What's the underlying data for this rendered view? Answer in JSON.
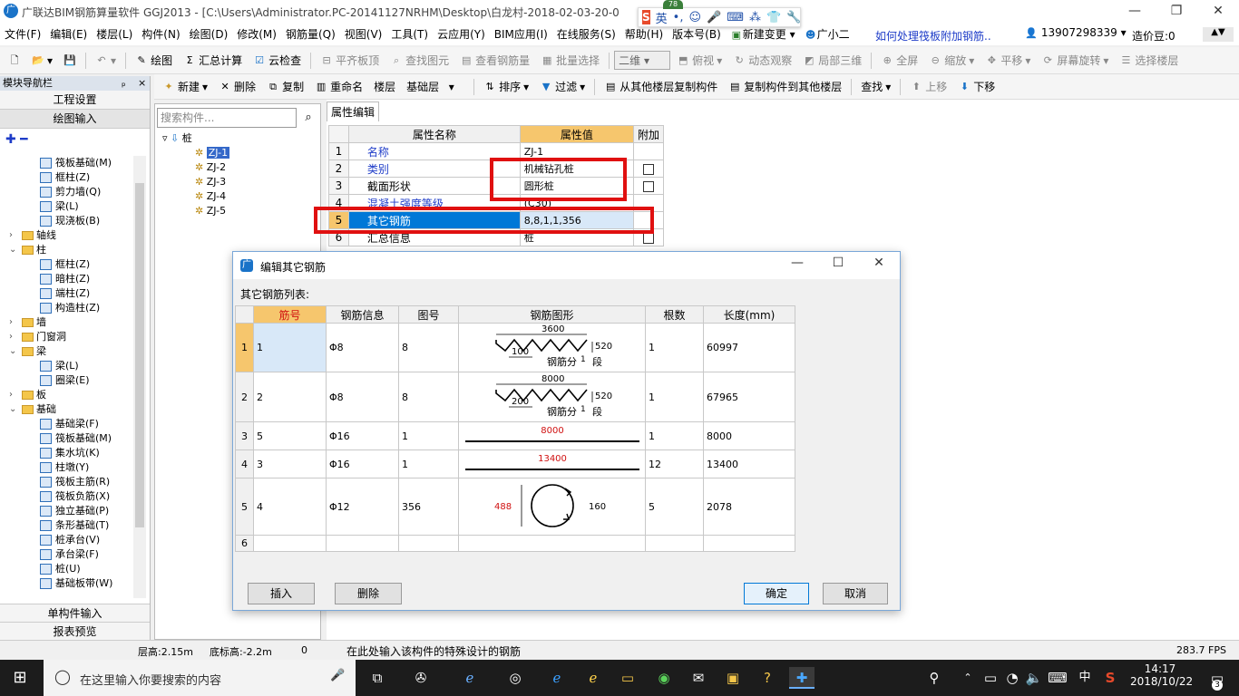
{
  "window": {
    "title": "广联达BIM钢筋算量软件 GGJ2013 - [C:\\Users\\Administrator.PC-20141127NRHM\\Desktop\\白龙村-2018-02-03-20-0"
  },
  "ime": {
    "badge": "78",
    "s": "S",
    "mode": "英"
  },
  "menu": {
    "items": [
      "文件(F)",
      "编辑(E)",
      "楼层(L)",
      "构件(N)",
      "绘图(D)",
      "修改(M)",
      "钢筋量(Q)",
      "视图(V)",
      "工具(T)",
      "云应用(Y)",
      "BIM应用(I)",
      "在线服务(S)",
      "帮助(H)",
      "版本号(B)",
      "新建变更",
      "广小二"
    ],
    "question": "如何处理筏板附加钢筋..",
    "phone": "13907298339",
    "coins": "造价豆:0"
  },
  "toolbar1": {
    "items": [
      "绘图",
      "汇总计算",
      "云检查",
      "平齐板顶",
      "查找图元",
      "查看钢筋量",
      "批量选择",
      "俯视",
      "动态观察",
      "局部三维",
      "全屏",
      "缩放",
      "平移",
      "屏幕旋转",
      "选择楼层"
    ],
    "view_combo": "二维"
  },
  "toolbar2": {
    "items": [
      "新建",
      "删除",
      "复制",
      "重命名",
      "楼层",
      "基础层",
      "排序",
      "过滤",
      "从其他楼层复制构件",
      "复制构件到其他楼层",
      "查找",
      "上移",
      "下移"
    ]
  },
  "nav": {
    "header": "模块导航栏",
    "pin": "ₚ",
    "close": "×",
    "buttons": [
      "工程设置",
      "绘图输入",
      "单构件输入",
      "报表预览"
    ],
    "tree": [
      {
        "label": "筏板基础(M)",
        "lvl": 2
      },
      {
        "label": "框柱(Z)",
        "lvl": 2
      },
      {
        "label": "剪力墙(Q)",
        "lvl": 2
      },
      {
        "label": "梁(L)",
        "lvl": 2
      },
      {
        "label": "现浇板(B)",
        "lvl": 2
      },
      {
        "label": "轴线",
        "lvl": 1,
        "ex": "+"
      },
      {
        "label": "柱",
        "lvl": 1,
        "ex": "−"
      },
      {
        "label": "框柱(Z)",
        "lvl": 2
      },
      {
        "label": "暗柱(Z)",
        "lvl": 2
      },
      {
        "label": "端柱(Z)",
        "lvl": 2
      },
      {
        "label": "构造柱(Z)",
        "lvl": 2
      },
      {
        "label": "墙",
        "lvl": 1,
        "ex": "+"
      },
      {
        "label": "门窗洞",
        "lvl": 1,
        "ex": "+"
      },
      {
        "label": "梁",
        "lvl": 1,
        "ex": "−"
      },
      {
        "label": "梁(L)",
        "lvl": 2
      },
      {
        "label": "圈梁(E)",
        "lvl": 2
      },
      {
        "label": "板",
        "lvl": 1,
        "ex": "+"
      },
      {
        "label": "基础",
        "lvl": 1,
        "ex": "−"
      },
      {
        "label": "基础梁(F)",
        "lvl": 2
      },
      {
        "label": "筏板基础(M)",
        "lvl": 2
      },
      {
        "label": "集水坑(K)",
        "lvl": 2
      },
      {
        "label": "柱墩(Y)",
        "lvl": 2
      },
      {
        "label": "筏板主筋(R)",
        "lvl": 2
      },
      {
        "label": "筏板负筋(X)",
        "lvl": 2
      },
      {
        "label": "独立基础(P)",
        "lvl": 2
      },
      {
        "label": "条形基础(T)",
        "lvl": 2
      },
      {
        "label": "桩承台(V)",
        "lvl": 2
      },
      {
        "label": "承台梁(F)",
        "lvl": 2
      },
      {
        "label": "桩(U)",
        "lvl": 2
      },
      {
        "label": "基础板带(W)",
        "lvl": 2
      }
    ]
  },
  "components": {
    "search_placeholder": "搜索构件...",
    "root": "桩",
    "items": [
      "ZJ-1",
      "ZJ-2",
      "ZJ-3",
      "ZJ-4",
      "ZJ-5"
    ]
  },
  "props": {
    "tab": "属性编辑",
    "col_name": "属性名称",
    "col_value": "属性值",
    "col_extra": "附加",
    "rows": [
      {
        "n": "1",
        "name": "名称",
        "value": "ZJ-1"
      },
      {
        "n": "2",
        "name": "类别",
        "value": "机械钻孔桩"
      },
      {
        "n": "3",
        "name": "截面形状",
        "value": "圆形桩"
      },
      {
        "n": "4",
        "name": "混凝土强度等级",
        "value": "(C30)"
      },
      {
        "n": "5",
        "name": "其它钢筋",
        "value": "8,8,1,1,356"
      },
      {
        "n": "6",
        "name": "汇总信息",
        "value": "桩"
      }
    ]
  },
  "dialog": {
    "title": "编辑其它钢筋",
    "list_label": "其它钢筋列表:",
    "cols": [
      "筋号",
      "钢筋信息",
      "图号",
      "钢筋图形",
      "根数",
      "长度(mm)"
    ],
    "rows": [
      {
        "n": "1",
        "no": "1",
        "info": "Φ8",
        "fig": "8",
        "count": "1",
        "len": "60997",
        "shape": "spiral",
        "d1": "3600",
        "d2": "100",
        "d3": "520",
        "t": "钢筋分",
        "t2": "1",
        "t3": "段"
      },
      {
        "n": "2",
        "no": "2",
        "info": "Φ8",
        "fig": "8",
        "count": "1",
        "len": "67965",
        "shape": "spiral",
        "d1": "8000",
        "d2": "200",
        "d3": "520",
        "t": "钢筋分",
        "t2": "1",
        "t3": "段"
      },
      {
        "n": "3",
        "no": "5",
        "info": "Φ16",
        "fig": "1",
        "count": "1",
        "len": "8000",
        "shape": "line",
        "d1": "8000"
      },
      {
        "n": "4",
        "no": "3",
        "info": "Φ16",
        "fig": "1",
        "count": "12",
        "len": "13400",
        "shape": "line",
        "d1": "13400"
      },
      {
        "n": "5",
        "no": "4",
        "info": "Φ12",
        "fig": "356",
        "count": "5",
        "len": "2078",
        "shape": "circle",
        "d1": "488",
        "d2": "160"
      },
      {
        "n": "6",
        "no": "",
        "info": "",
        "fig": "",
        "count": "",
        "len": "",
        "shape": "none"
      }
    ],
    "btn_insert": "插入",
    "btn_delete": "删除",
    "btn_ok": "确定",
    "btn_cancel": "取消"
  },
  "status": {
    "floor_h": "层高:2.15m",
    "base_h": "底标高:-2.2m",
    "zero": "0",
    "hint": "在此处输入该构件的特殊设计的钢筋",
    "fps": "283.7 FPS"
  },
  "taskbar": {
    "search": "在这里输入你要搜索的内容",
    "time": "14:17",
    "date": "2018/10/22",
    "lang": "中",
    "notif": "3"
  }
}
